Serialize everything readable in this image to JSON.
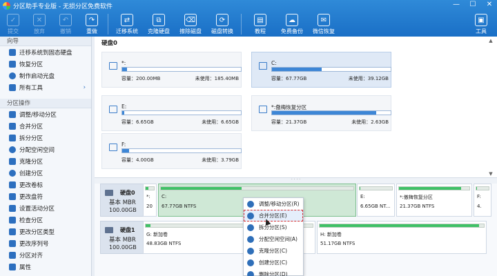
{
  "window": {
    "title": "分区助手专业版 - 无损分区免费软件"
  },
  "toolbar": {
    "items": [
      {
        "label": "提交",
        "icon": "✓",
        "enabled": false
      },
      {
        "label": "放弃",
        "icon": "✕",
        "enabled": false
      },
      {
        "label": "撤销",
        "icon": "↶",
        "enabled": false
      },
      {
        "label": "重做",
        "icon": "↷",
        "enabled": true
      },
      {
        "label": "迁移系统",
        "icon": "⇄",
        "enabled": true
      },
      {
        "label": "克隆硬盘",
        "icon": "⧉",
        "enabled": true
      },
      {
        "label": "擦除磁盘",
        "icon": "⌫",
        "enabled": true
      },
      {
        "label": "磁盘转换",
        "icon": "⟳",
        "enabled": true
      },
      {
        "label": "教程",
        "icon": "▤",
        "enabled": true
      },
      {
        "label": "免费备份",
        "icon": "☁",
        "enabled": true
      },
      {
        "label": "微信恢复",
        "icon": "✉",
        "enabled": true
      }
    ],
    "tools_label": "工具"
  },
  "sidebar": {
    "wizard_title": "向导",
    "wizard_items": [
      "迁移系统到固态硬盘",
      "恢复分区",
      "制作启动光盘",
      "所有工具"
    ],
    "ops_title": "分区操作",
    "ops_items": [
      "调整/移动分区",
      "合并分区",
      "拆分分区",
      "分配空闲空间",
      "克隆分区",
      "创建分区",
      "更改卷标",
      "更改盘符",
      "设置活动分区",
      "检查分区",
      "更改分区类型",
      "更改序列号",
      "分区对齐",
      "属性"
    ]
  },
  "upper": {
    "disk_label": "硬盘0",
    "cards": [
      {
        "name": "*:",
        "fill": 0.04,
        "cap": "容量：200.00MB",
        "free": "未使用：185.40MB",
        "selected": false
      },
      {
        "name": "C:",
        "fill": 0.42,
        "cap": "容量：67.77GB",
        "free": "未使用：39.12GB",
        "selected": true
      },
      {
        "name": "E:",
        "fill": 0.02,
        "cap": "容量：6.65GB",
        "free": "未使用：6.65GB",
        "selected": false
      },
      {
        "name": "*:傲梅恢复分区",
        "fill": 0.88,
        "cap": "容量：21.37GB",
        "free": "未使用：2.63GB",
        "selected": false
      },
      {
        "name": "F:",
        "fill": 0.06,
        "cap": "容量：4.00GB",
        "free": "未使用：3.79GB",
        "selected": false
      }
    ]
  },
  "disks": [
    {
      "name": "硬盘0",
      "type": "基本 MBR",
      "size": "100.00GB",
      "parts": [
        {
          "label": "*:",
          "size": "20",
          "fill": 0.3,
          "selected": false
        },
        {
          "label": "C:",
          "size": "67.77GB NTFS",
          "fill": 0.42,
          "selected": true
        },
        {
          "label": "E:",
          "size": "6.65GB NT...",
          "fill": 0.02,
          "selected": false
        },
        {
          "label": "*:傲梅恢复分区",
          "size": "21.37GB NTFS",
          "fill": 0.88,
          "selected": false
        },
        {
          "label": "F:",
          "size": "4.",
          "fill": 0.06,
          "selected": false
        }
      ]
    },
    {
      "name": "硬盘1",
      "type": "基本 MBR",
      "size": "100.00GB",
      "parts": [
        {
          "label": "G: 新加卷",
          "size": "48.83GB NTFS",
          "fill": 0.03,
          "selected": false
        },
        {
          "label": "H: 新加卷",
          "size": "51.17GB NTFS",
          "fill": 0.97,
          "selected": false
        }
      ]
    }
  ],
  "context_menu": {
    "items": [
      "调整/移动分区(R)",
      "合并分区(E)",
      "拆分分区(S)",
      "分配空闲空间(A)",
      "克隆分区(C)",
      "创建分区(C)",
      "删除分区(D)"
    ],
    "highlighted_index": 1
  }
}
